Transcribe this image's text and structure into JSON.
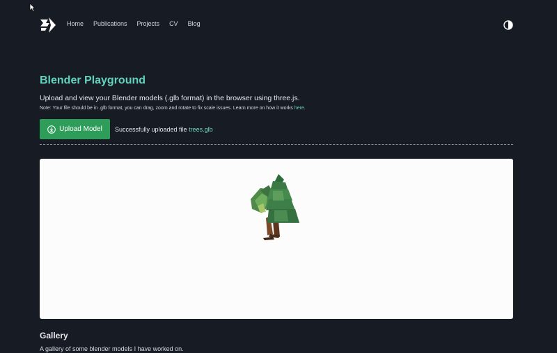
{
  "nav": {
    "items": [
      "Home",
      "Publications",
      "Projects",
      "CV",
      "Blog"
    ]
  },
  "page": {
    "title": "Blender Playground",
    "subtitle": "Upload and view your Blender models (.glb format) in the browser using three.js.",
    "note_prefix": "Note: Your file should be in .glb format, you can drag, zoom and rotate to fix scale issues. Learn more on how it works ",
    "note_link": "here",
    "note_suffix": "."
  },
  "upload": {
    "button_label": "Upload Model",
    "status_prefix": "Successfully uploaded file ",
    "file_name": "trees.glb"
  },
  "gallery": {
    "title": "Gallery",
    "description": "A gallery of some blender models I have worked on."
  },
  "colors": {
    "background": "#171b24",
    "accent": "#62d2be",
    "button": "#2e9d5a",
    "viewer_bg": "#fcfcfc"
  },
  "icons": {
    "logo": "logo-icon",
    "theme": "contrast-icon",
    "upload": "download-circle-icon",
    "cursor": "cursor-icon"
  }
}
